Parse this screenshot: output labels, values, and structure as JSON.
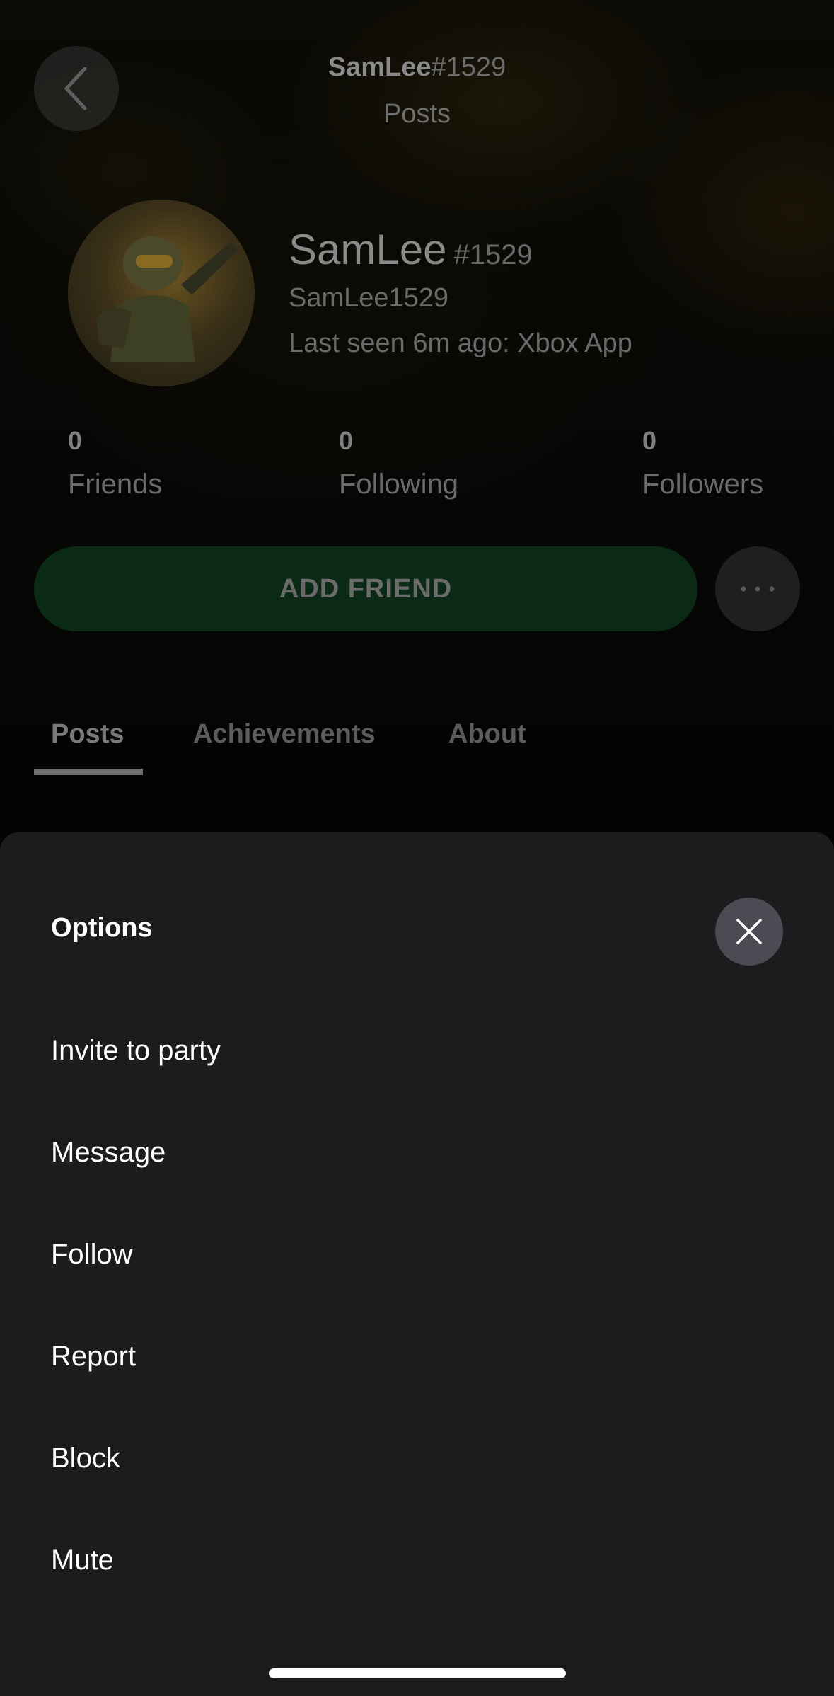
{
  "header": {
    "gamertag": "SamLee",
    "suffix": "#1529",
    "subtitle": "Posts"
  },
  "profile": {
    "name": "SamLee",
    "suffix": "#1529",
    "real_name": "SamLee1529",
    "last_seen": "Last seen 6m ago: Xbox App"
  },
  "stats": [
    {
      "value": "0",
      "label": "Friends"
    },
    {
      "value": "0",
      "label": "Following"
    },
    {
      "value": "0",
      "label": "Followers"
    }
  ],
  "actions": {
    "add_friend": "ADD FRIEND",
    "more_icon": "ellipsis-icon"
  },
  "tabs": [
    {
      "label": "Posts",
      "active": true
    },
    {
      "label": "Achievements",
      "active": false
    },
    {
      "label": "About",
      "active": false
    }
  ],
  "sheet": {
    "title": "Options",
    "close_icon": "close-icon",
    "options": [
      "Invite to party",
      "Message",
      "Follow",
      "Report",
      "Block",
      "Mute"
    ]
  },
  "colors": {
    "accent_green": "#0a2a15",
    "sheet_bg": "#1c1c1f",
    "close_btn_bg": "#4b4c53"
  }
}
